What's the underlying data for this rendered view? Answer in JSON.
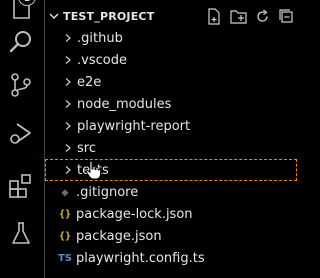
{
  "activity_bar": {
    "badge_count": "1",
    "items": [
      {
        "name": "explorer",
        "icon": "files-icon"
      },
      {
        "name": "search",
        "icon": "search-icon"
      },
      {
        "name": "source-control",
        "icon": "source-control-icon"
      },
      {
        "name": "run-and-debug",
        "icon": "run-debug-icon"
      },
      {
        "name": "extensions",
        "icon": "extensions-icon"
      },
      {
        "name": "testing",
        "icon": "flask-icon"
      }
    ]
  },
  "explorer": {
    "project_title": "TEST_PROJECT",
    "actions": [
      "new-file-icon",
      "new-folder-icon",
      "refresh-icon",
      "collapse-all-icon"
    ],
    "folders": [
      ".github",
      ".vscode",
      "e2e",
      "node_modules",
      "playwright-report",
      "src",
      "tests"
    ],
    "drop_target_folder": "tests",
    "files": [
      {
        "name": ".gitignore",
        "icon": "gitignore-icon",
        "glyph": "◆"
      },
      {
        "name": "package-lock.json",
        "icon": "json-icon",
        "glyph": "{}"
      },
      {
        "name": "package.json",
        "icon": "json-icon",
        "glyph": "{}"
      },
      {
        "name": "playwright.config.ts",
        "icon": "typescript-icon",
        "glyph": "TS"
      }
    ]
  },
  "colors": {
    "background": "#000000",
    "drop_outline": "#f38518",
    "json_icon": "#d8c23a",
    "ts_icon": "#4f8fd6"
  }
}
